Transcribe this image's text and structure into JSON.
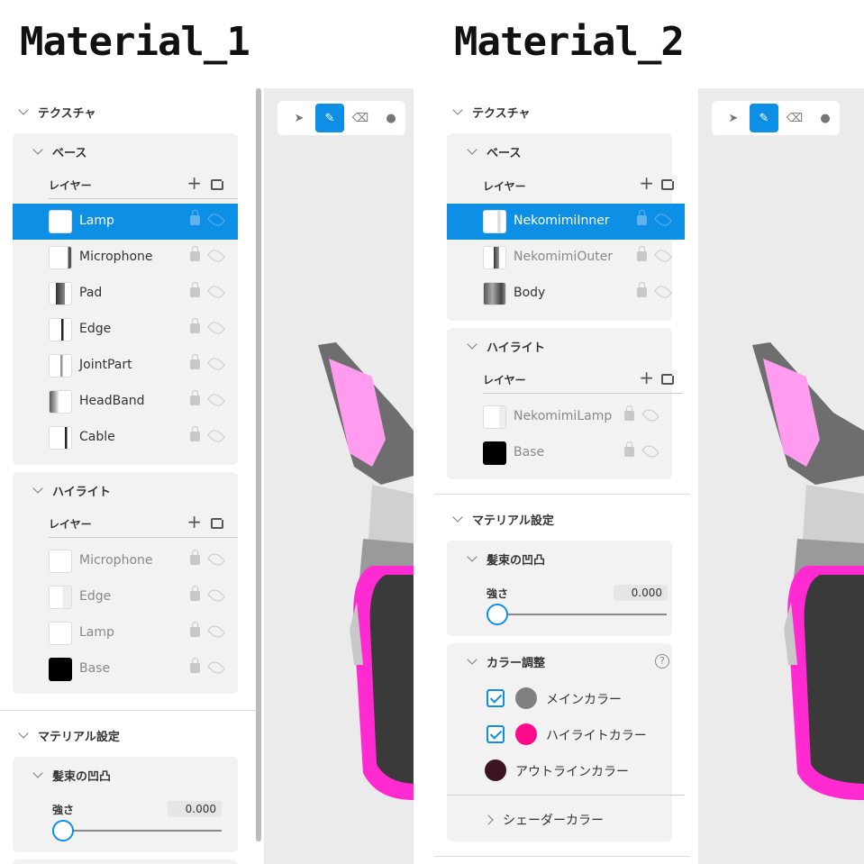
{
  "titles": {
    "left": "Material_1",
    "right": "Material_2"
  },
  "labels": {
    "texture": "テクスチャ",
    "base": "ベース",
    "highlight": "ハイライト",
    "layer": "レイヤー",
    "material_settings": "マテリアル設定",
    "hair_bump": "髪束の凹凸",
    "strength": "強さ",
    "color_adjust": "カラー調整",
    "shader_color": "シェーダーカラー"
  },
  "left": {
    "base_layers": [
      "Lamp",
      "Microphone",
      "Pad",
      "Edge",
      "JointPart",
      "HeadBand",
      "Cable"
    ],
    "highlight_layers": [
      "Microphone",
      "Edge",
      "Lamp",
      "Base"
    ],
    "strength_value": "0.000"
  },
  "right": {
    "base_layers": [
      "NekomimiInner",
      "NekomimiOuter",
      "Body"
    ],
    "highlight_layers": [
      "NekomimiLamp",
      "Base"
    ],
    "strength_value": "0.000",
    "colors": [
      {
        "label": "メインカラー",
        "color": "#808080",
        "checked": true
      },
      {
        "label": "ハイライトカラー",
        "color": "#ff0a8c",
        "checked": true
      },
      {
        "label": "アウトラインカラー",
        "color": "#3a141e",
        "checked": false
      }
    ]
  },
  "icons": [
    "cursor-icon",
    "pencil-icon",
    "eraser-icon",
    "drop-icon",
    "plus-icon",
    "add-image-icon",
    "lock-icon",
    "eye-off-icon",
    "help-icon",
    "chevron-icon"
  ],
  "accent": "#0d8fe6"
}
